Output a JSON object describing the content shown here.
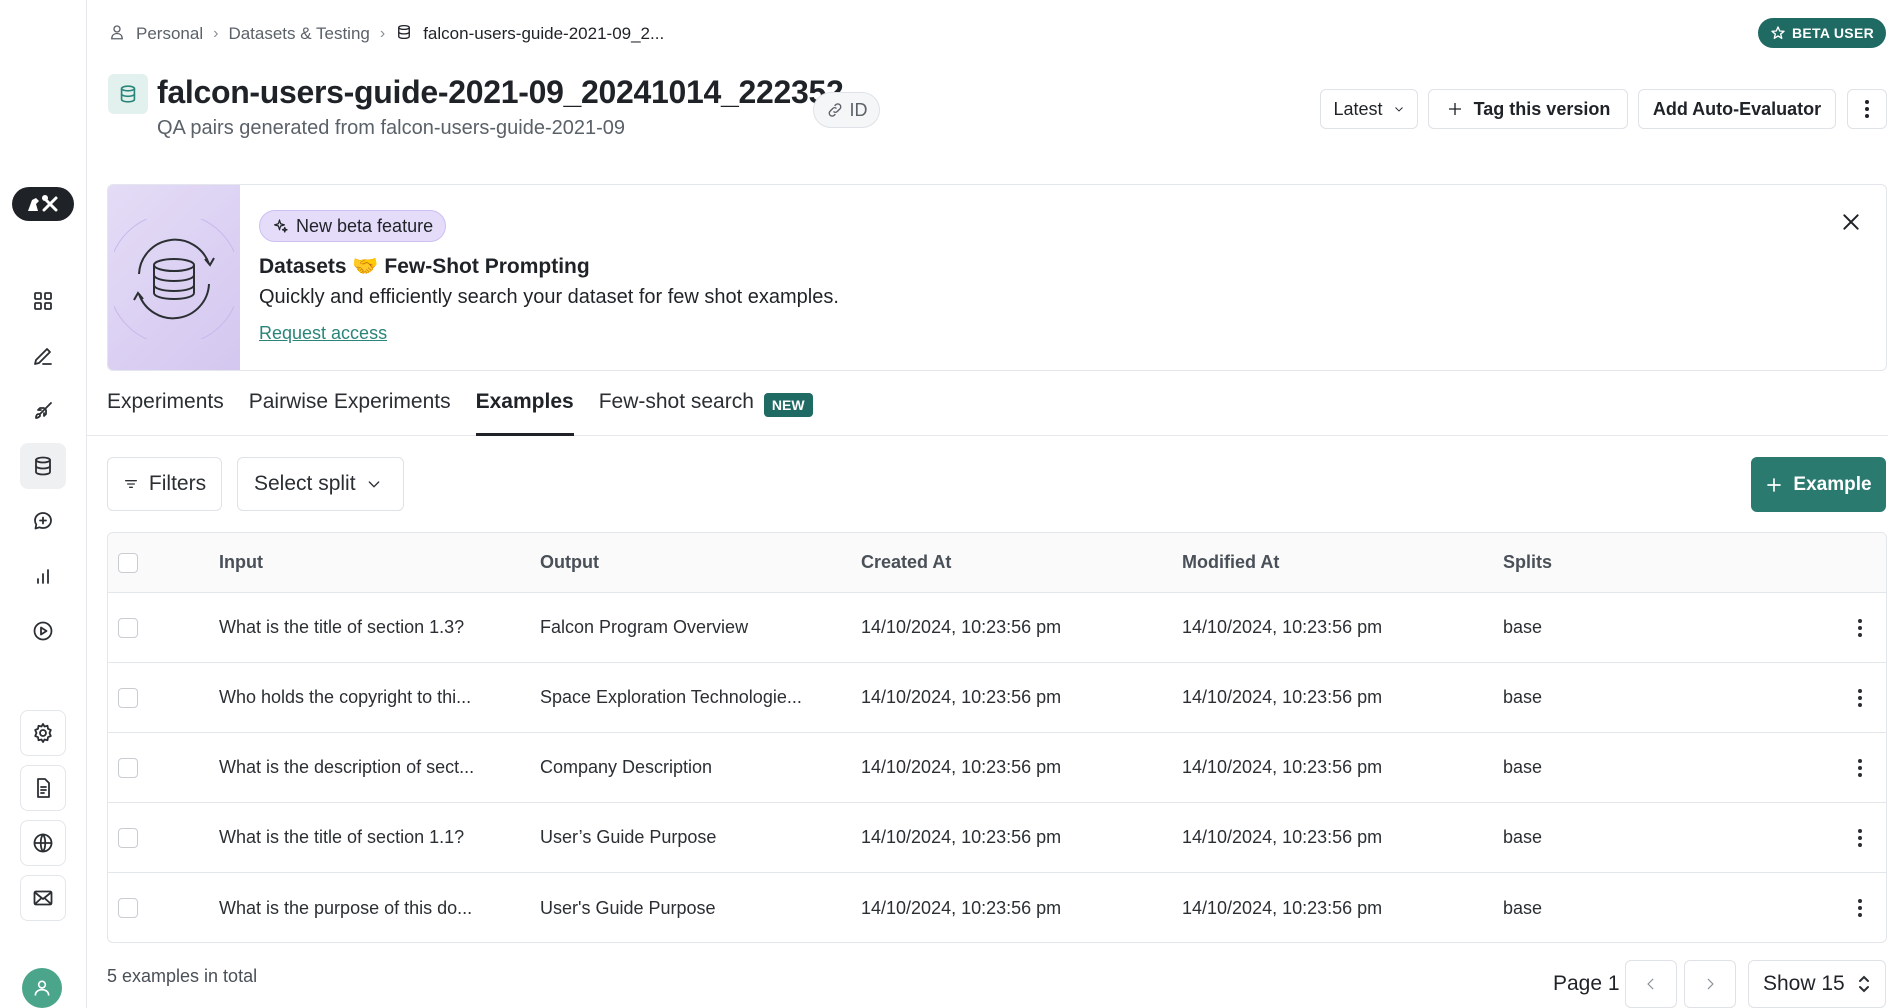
{
  "breadcrumb": {
    "items": [
      "Personal",
      "Datasets & Testing",
      "falcon-users-guide-2021-09_2..."
    ]
  },
  "beta_badge": "BETA USER",
  "header": {
    "title": "falcon-users-guide-2021-09_20241014_222352",
    "subtitle": "QA pairs generated from falcon-users-guide-2021-09",
    "id_label": "ID",
    "version_select": "Latest",
    "tag_button": "Tag this version",
    "auto_eval_button": "Add Auto-Evaluator"
  },
  "banner": {
    "badge": "New beta feature",
    "heading": "Datasets 🤝 Few-Shot Prompting",
    "description": "Quickly and efficiently search your dataset for few shot examples.",
    "link": "Request access"
  },
  "tabs": [
    {
      "label": "Experiments",
      "active": false
    },
    {
      "label": "Pairwise Experiments",
      "active": false
    },
    {
      "label": "Examples",
      "active": true
    },
    {
      "label": "Few-shot search",
      "active": false,
      "badge": "NEW"
    }
  ],
  "toolbar": {
    "filters_label": "Filters",
    "split_label": "Select split",
    "add_example_label": "Example"
  },
  "table": {
    "columns": [
      "Input",
      "Output",
      "Created At",
      "Modified At",
      "Splits"
    ],
    "rows": [
      {
        "input": "What is the title of section 1.3?",
        "output": "Falcon Program Overview",
        "created": "14/10/2024, 10:23:56 pm",
        "modified": "14/10/2024, 10:23:56 pm",
        "split": "base"
      },
      {
        "input": "Who holds the copyright to thi...",
        "output": "Space Exploration Technologie...",
        "created": "14/10/2024, 10:23:56 pm",
        "modified": "14/10/2024, 10:23:56 pm",
        "split": "base"
      },
      {
        "input": "What is the description of sect...",
        "output": "Company Description",
        "created": "14/10/2024, 10:23:56 pm",
        "modified": "14/10/2024, 10:23:56 pm",
        "split": "base"
      },
      {
        "input": "What is the title of section 1.1?",
        "output": "User’s Guide Purpose",
        "created": "14/10/2024, 10:23:56 pm",
        "modified": "14/10/2024, 10:23:56 pm",
        "split": "base"
      },
      {
        "input": "What is the purpose of this do...",
        "output": "User's Guide Purpose",
        "created": "14/10/2024, 10:23:56 pm",
        "modified": "14/10/2024, 10:23:56 pm",
        "split": "base"
      }
    ]
  },
  "footer": {
    "total": "5 examples in total",
    "page": "Page 1",
    "show": "Show 15"
  },
  "colors": {
    "accent": "#2a7a70",
    "badge": "#1f6a63",
    "link": "#2a8579"
  }
}
